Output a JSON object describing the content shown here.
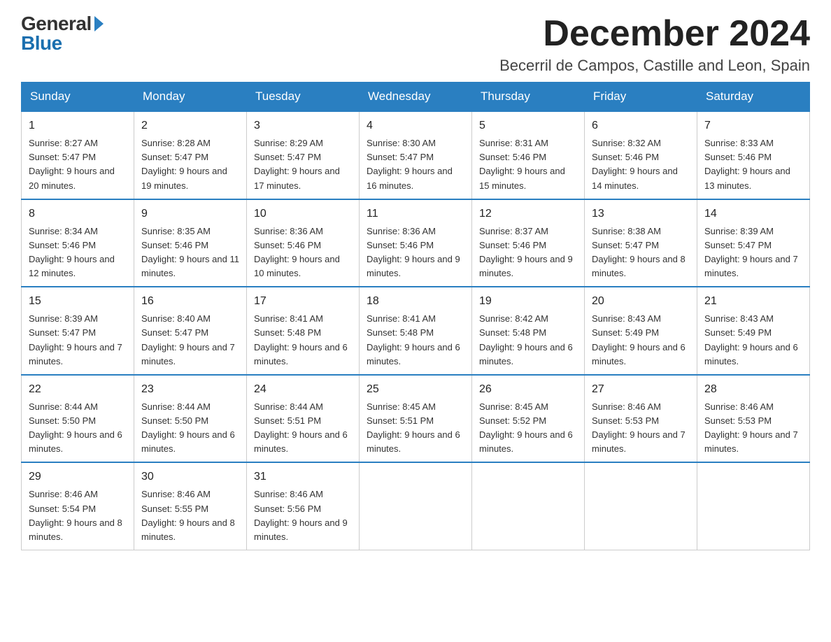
{
  "logo": {
    "general": "General",
    "blue": "Blue",
    "arrow": "▶"
  },
  "header": {
    "month_year": "December 2024",
    "location": "Becerril de Campos, Castille and Leon, Spain"
  },
  "weekdays": [
    "Sunday",
    "Monday",
    "Tuesday",
    "Wednesday",
    "Thursday",
    "Friday",
    "Saturday"
  ],
  "weeks": [
    [
      {
        "day": "1",
        "sunrise": "8:27 AM",
        "sunset": "5:47 PM",
        "daylight": "9 hours and 20 minutes."
      },
      {
        "day": "2",
        "sunrise": "8:28 AM",
        "sunset": "5:47 PM",
        "daylight": "9 hours and 19 minutes."
      },
      {
        "day": "3",
        "sunrise": "8:29 AM",
        "sunset": "5:47 PM",
        "daylight": "9 hours and 17 minutes."
      },
      {
        "day": "4",
        "sunrise": "8:30 AM",
        "sunset": "5:47 PM",
        "daylight": "9 hours and 16 minutes."
      },
      {
        "day": "5",
        "sunrise": "8:31 AM",
        "sunset": "5:46 PM",
        "daylight": "9 hours and 15 minutes."
      },
      {
        "day": "6",
        "sunrise": "8:32 AM",
        "sunset": "5:46 PM",
        "daylight": "9 hours and 14 minutes."
      },
      {
        "day": "7",
        "sunrise": "8:33 AM",
        "sunset": "5:46 PM",
        "daylight": "9 hours and 13 minutes."
      }
    ],
    [
      {
        "day": "8",
        "sunrise": "8:34 AM",
        "sunset": "5:46 PM",
        "daylight": "9 hours and 12 minutes."
      },
      {
        "day": "9",
        "sunrise": "8:35 AM",
        "sunset": "5:46 PM",
        "daylight": "9 hours and 11 minutes."
      },
      {
        "day": "10",
        "sunrise": "8:36 AM",
        "sunset": "5:46 PM",
        "daylight": "9 hours and 10 minutes."
      },
      {
        "day": "11",
        "sunrise": "8:36 AM",
        "sunset": "5:46 PM",
        "daylight": "9 hours and 9 minutes."
      },
      {
        "day": "12",
        "sunrise": "8:37 AM",
        "sunset": "5:46 PM",
        "daylight": "9 hours and 9 minutes."
      },
      {
        "day": "13",
        "sunrise": "8:38 AM",
        "sunset": "5:47 PM",
        "daylight": "9 hours and 8 minutes."
      },
      {
        "day": "14",
        "sunrise": "8:39 AM",
        "sunset": "5:47 PM",
        "daylight": "9 hours and 7 minutes."
      }
    ],
    [
      {
        "day": "15",
        "sunrise": "8:39 AM",
        "sunset": "5:47 PM",
        "daylight": "9 hours and 7 minutes."
      },
      {
        "day": "16",
        "sunrise": "8:40 AM",
        "sunset": "5:47 PM",
        "daylight": "9 hours and 7 minutes."
      },
      {
        "day": "17",
        "sunrise": "8:41 AM",
        "sunset": "5:48 PM",
        "daylight": "9 hours and 6 minutes."
      },
      {
        "day": "18",
        "sunrise": "8:41 AM",
        "sunset": "5:48 PM",
        "daylight": "9 hours and 6 minutes."
      },
      {
        "day": "19",
        "sunrise": "8:42 AM",
        "sunset": "5:48 PM",
        "daylight": "9 hours and 6 minutes."
      },
      {
        "day": "20",
        "sunrise": "8:43 AM",
        "sunset": "5:49 PM",
        "daylight": "9 hours and 6 minutes."
      },
      {
        "day": "21",
        "sunrise": "8:43 AM",
        "sunset": "5:49 PM",
        "daylight": "9 hours and 6 minutes."
      }
    ],
    [
      {
        "day": "22",
        "sunrise": "8:44 AM",
        "sunset": "5:50 PM",
        "daylight": "9 hours and 6 minutes."
      },
      {
        "day": "23",
        "sunrise": "8:44 AM",
        "sunset": "5:50 PM",
        "daylight": "9 hours and 6 minutes."
      },
      {
        "day": "24",
        "sunrise": "8:44 AM",
        "sunset": "5:51 PM",
        "daylight": "9 hours and 6 minutes."
      },
      {
        "day": "25",
        "sunrise": "8:45 AM",
        "sunset": "5:51 PM",
        "daylight": "9 hours and 6 minutes."
      },
      {
        "day": "26",
        "sunrise": "8:45 AM",
        "sunset": "5:52 PM",
        "daylight": "9 hours and 6 minutes."
      },
      {
        "day": "27",
        "sunrise": "8:46 AM",
        "sunset": "5:53 PM",
        "daylight": "9 hours and 7 minutes."
      },
      {
        "day": "28",
        "sunrise": "8:46 AM",
        "sunset": "5:53 PM",
        "daylight": "9 hours and 7 minutes."
      }
    ],
    [
      {
        "day": "29",
        "sunrise": "8:46 AM",
        "sunset": "5:54 PM",
        "daylight": "9 hours and 8 minutes."
      },
      {
        "day": "30",
        "sunrise": "8:46 AM",
        "sunset": "5:55 PM",
        "daylight": "9 hours and 8 minutes."
      },
      {
        "day": "31",
        "sunrise": "8:46 AM",
        "sunset": "5:56 PM",
        "daylight": "9 hours and 9 minutes."
      },
      null,
      null,
      null,
      null
    ]
  ]
}
